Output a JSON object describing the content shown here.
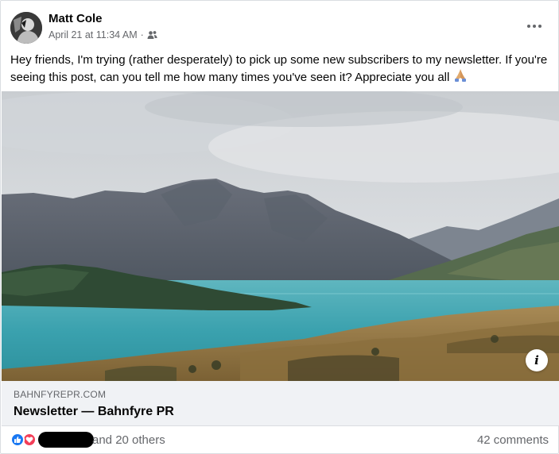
{
  "post": {
    "author": "Matt Cole",
    "timestamp": "April 21 at 11:34 AM",
    "separator": "·",
    "audience_icon": "friends-icon",
    "message": "Hey friends, I'm trying (rather desperately) to pick up some new subscribers to my newsletter. If you're seeing this post, can you tell me how many times you've seen it? Appreciate you all",
    "message_emoji": "folded-hands-icon"
  },
  "link_preview": {
    "domain": "BAHNFYREPR.COM",
    "title": "Newsletter — Bahnfyre PR",
    "image": "mountain-lake-landscape",
    "info_label": "i"
  },
  "engagement": {
    "reaction_icons": [
      "like-icon",
      "love-icon"
    ],
    "others_text": "and 20 others",
    "comments_text": "42 comments"
  },
  "colors": {
    "like": "#1877f2",
    "love": "#f33e58",
    "secondary_text": "#65676b",
    "preview_bg": "#f0f2f5"
  }
}
